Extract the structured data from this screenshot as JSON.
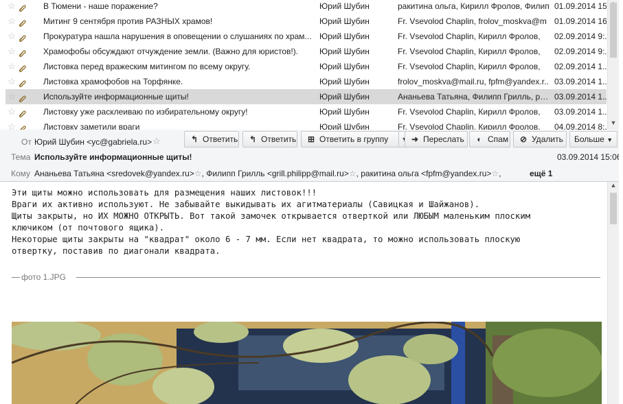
{
  "messages": [
    {
      "subject": "В Тюмени - наше поражение?",
      "from": "Юрий Шубин",
      "to": "ракитина ольга, Кирилл Фролов, Филип",
      "date": "01.09.2014 15:",
      "selected": false
    },
    {
      "subject": "Митинг 9 сентября против РАЗНЫХ храмов!",
      "from": "Юрий Шубин",
      "to": "Fr. Vsevolod Chaplin, frolov_moskva@m",
      "date": "01.09.2014 16:",
      "selected": false
    },
    {
      "subject": "Прокуратура нашла нарушения в оповещении о слушаниях по храм...",
      "from": "Юрий Шубин",
      "to": "Fr. Vsevolod Chaplin, Кирилл Фролов,",
      "date": "02.09.2014 9:..",
      "selected": false
    },
    {
      "subject": "Храмофобы обсуждают отчуждение земли. (Важно для юристов!).",
      "from": "Юрий Шубин",
      "to": "Fr. Vsevolod Chaplin, Кирилл Фролов,",
      "date": "02.09.2014 9:..",
      "selected": false
    },
    {
      "subject": "Листовка перед вражеским митингом по всему округу.",
      "from": "Юрий Шубин",
      "to": "Fr. Vsevolod Chaplin, Кирилл Фролов,",
      "date": "02.09.2014 1..",
      "selected": false
    },
    {
      "subject": "Листовка храмофобов на Торфянке.",
      "from": "Юрий Шубин",
      "to": "frolov_moskva@mail.ru, fpfm@yandex.r..",
      "date": "03.09.2014 1..",
      "selected": false
    },
    {
      "subject": "Используйте информационные щиты!",
      "from": "Юрий Шубин",
      "to": "Ананьева Татьяна, Филипп Грилль, ра...",
      "date": "03.09.2014 1..",
      "selected": true
    },
    {
      "subject": "Листовку уже расклеиваю по избирательному округу!",
      "from": "Юрий Шубин",
      "to": "Fr. Vsevolod Chaplin, Кирилл Фролов,",
      "date": "03.09.2014 1..",
      "selected": false
    },
    {
      "subject": "Листовку заметили враги",
      "from": "Юрий Шубин",
      "to": "Fr. Vsevolod Chaplin, Кирилл Фролов,",
      "date": "04.09.2014 8:..",
      "selected": false
    }
  ],
  "header": {
    "from_label": "От",
    "from_value": "Юрий Шубин <yc@gabriela.ru>",
    "subject_label": "Тема",
    "subject_value": "Используйте информационные щиты!",
    "date_value": "03.09.2014 15:06",
    "to_label": "Кому",
    "to_recipients": [
      "Ананьева Татьяна <sredovek@yandex.ru>",
      "Филипп Грилль <grill.philipp@mail.ru>",
      "ракитина ольга <fpfm@yandex.ru>"
    ],
    "more_recipients": "ещё 1"
  },
  "toolbar": {
    "reply": "Ответить",
    "reply_all": "Ответить",
    "reply_group": "Ответить в группу",
    "forward": "Переслать",
    "spam": "Спам",
    "delete": "Удалить",
    "more": "Больше"
  },
  "body": {
    "text": "Эти щиты можно использовать для размещения наших листовок!!!\nВраги их активно используют. Не забывайте выкидывать их агитматериалы (Савицкая и Шайжанов).\nЩиты закрыты, но ИХ МОЖНО ОТКРЫТЬ. Вот такой замочек открывается отверткой или ЛЮБЫМ маленьким плоским\nключиком (от почтового ящика).\nНекоторые щиты закрыты на \"квадрат\" около 6 - 7 мм. Если нет квадрата, то можно использовать плоскую\nотвертку, поставив по диагонали квадрата.",
    "attachment_label": "фото 1.JPG"
  },
  "colors": {
    "selected_row": "#d9d9d9",
    "header_bg": "#f4f5f7"
  }
}
